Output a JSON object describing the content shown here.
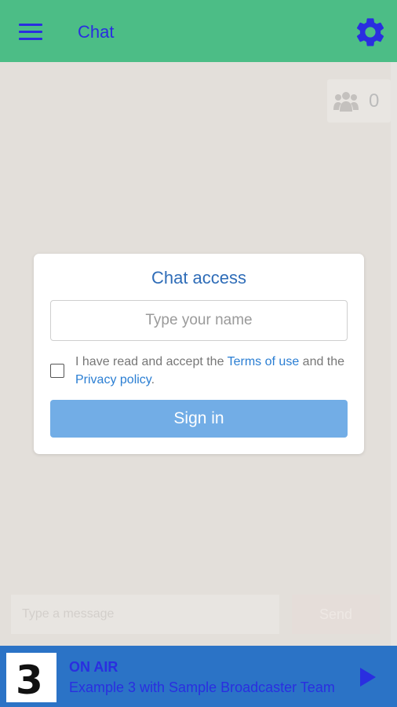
{
  "app": {
    "title": "Chat",
    "header_color": "#4cbd86",
    "accent_color": "#2a2ee0",
    "menu_icon": "hamburger-menu-icon",
    "settings_icon": "gear-icon"
  },
  "chat": {
    "online_users_icon": "users-group-icon",
    "online_users_count": "0",
    "message_placeholder": "Type a message",
    "send_label": "Send"
  },
  "access_card": {
    "title": "Chat access",
    "name_placeholder": "Type your name",
    "name_value": "",
    "consent_prefix": "I have read and accept the ",
    "terms_link": "Terms of use",
    "consent_middle": " and the ",
    "privacy_link": "Privacy policy",
    "consent_suffix": ".",
    "consent_checked": false,
    "signin_label": "Sign in",
    "signin_color": "#72ade6",
    "link_color": "#2a7ed3"
  },
  "player": {
    "station_logo_text": "3",
    "status": "ON AIR",
    "now_playing": "Example 3 with Sample Broadcaster Team",
    "play_icon": "play-icon",
    "background_color": "#2b73c6"
  }
}
